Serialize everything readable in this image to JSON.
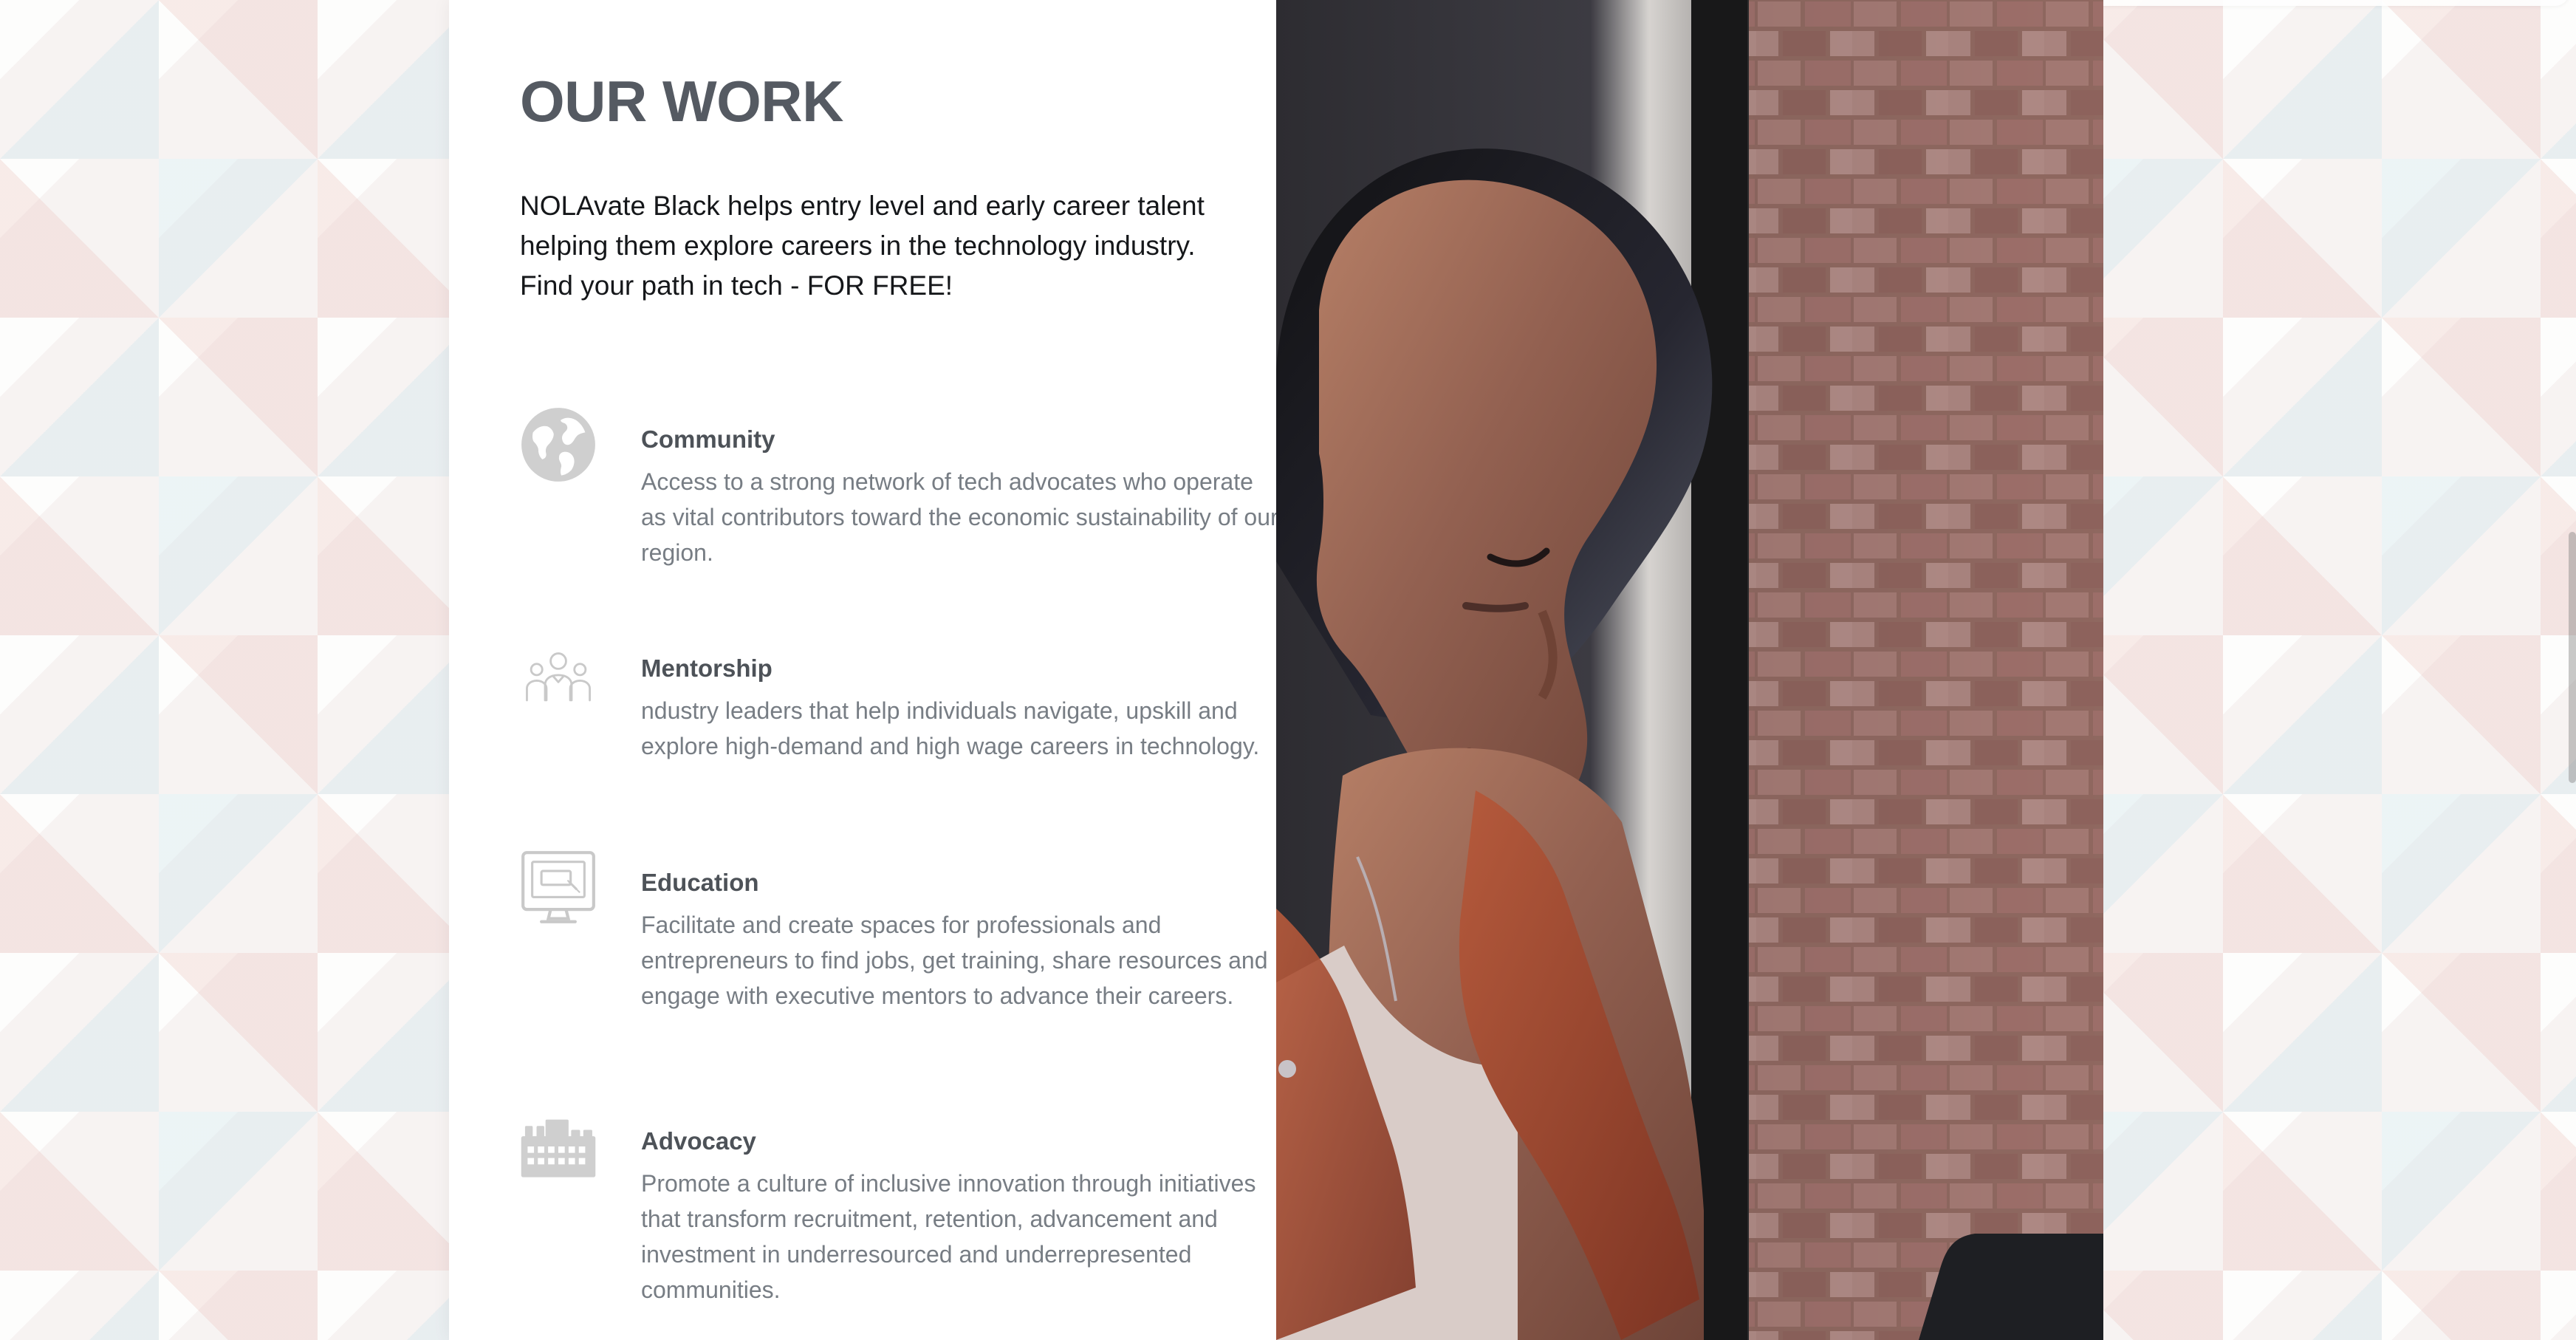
{
  "hero": {
    "title": "OUR WORK",
    "intro": "NOLAvate Black helps entry level and early career talent helping them explore careers in the technology industry. Find your path in tech - FOR FREE!"
  },
  "features": [
    {
      "title": "Community",
      "description": "Access to a strong network of tech advocates who operate as vital contributors toward the economic sustainability of our region.",
      "icon": "globe-icon"
    },
    {
      "title": "Mentorship",
      "description": "ndustry leaders that help individuals navigate, upskill and explore high-demand and high wage careers in technology.",
      "icon": "people-group-icon"
    },
    {
      "title": "Education",
      "description": "Facilitate and create spaces for professionals and entrepreneurs to find jobs, get training, share resources and engage with executive mentors to advance their careers.",
      "icon": "monitor-icon"
    },
    {
      "title": "Advocacy",
      "description": "Promote a culture of inclusive innovation through initiatives that transform recruitment, retention, advancement and investment in underresourced and underrepresented communities.",
      "icon": "building-icon"
    }
  ],
  "colors": {
    "title": "#555a62",
    "body": "#15171a",
    "muted": "#777d84",
    "icon": "#cfcfcf",
    "accent_orange": "#b55a3c"
  }
}
